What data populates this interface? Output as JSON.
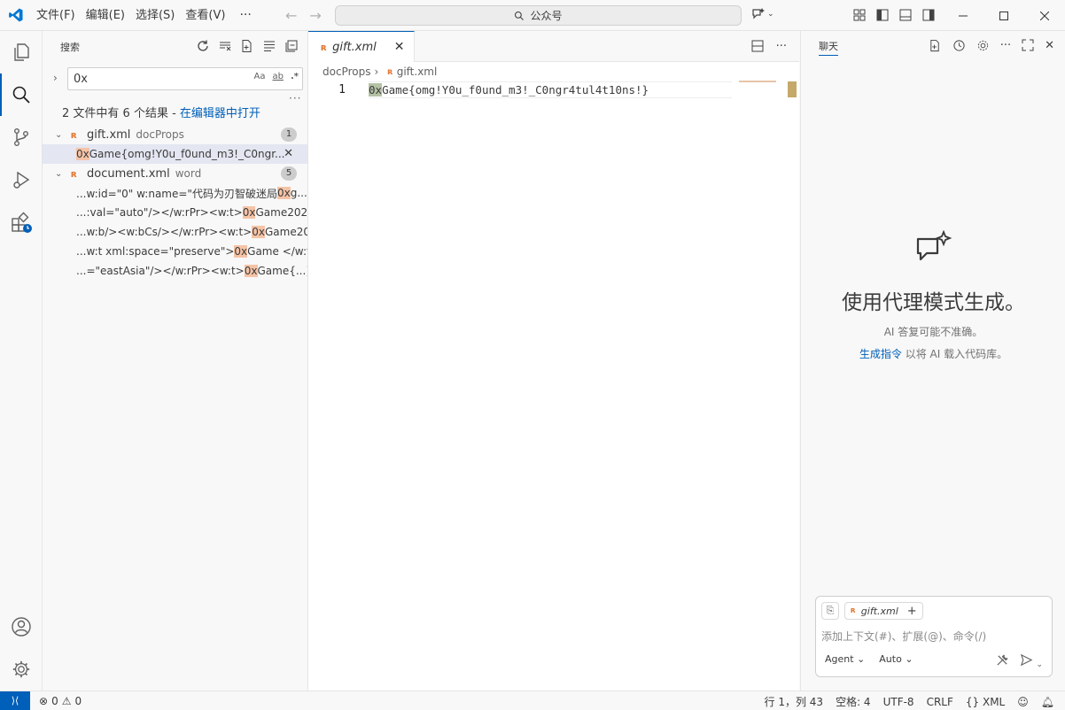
{
  "menu": {
    "items": [
      "文件(F)",
      "编辑(E)",
      "选择(S)",
      "查看(V)"
    ],
    "more": "···"
  },
  "command_center": {
    "text": "公众号"
  },
  "sidebar": {
    "title": "搜索",
    "search": {
      "value": "0x",
      "opt_case": "Aa",
      "opt_word": "ab",
      "opt_regex": ".*"
    },
    "summary": {
      "text": "2 文件中有 6 个结果 - ",
      "link": "在编辑器中打开"
    },
    "files": [
      {
        "name": "gift.xml",
        "dir": "docProps",
        "count": "1",
        "matches": [
          {
            "pre": "",
            "hl": "0x",
            "post": "Game{omg!Y0u_f0und_m3!_C0ngr..."
          }
        ]
      },
      {
        "name": "document.xml",
        "dir": "word",
        "count": "5",
        "matches": [
          {
            "pre": "...w:id=\"0\" w:name=\"代码为刃智破迷局",
            "hl": "0x",
            "post": "g..."
          },
          {
            "pre": "...:val=\"auto\"/></w:rPr><w:t>",
            "hl": "0x",
            "post": "Game2025..."
          },
          {
            "pre": "...w:b/><w:bCs/></w:rPr><w:t>",
            "hl": "0x",
            "post": "Game20..."
          },
          {
            "pre": "...w:t xml:space=\"preserve\"> ",
            "hl": "0x",
            "post": "Game </w:t..."
          },
          {
            "pre": "...=\"eastAsia\"/></w:rPr><w:t>",
            "hl": "0x",
            "post": "Game{...}<..."
          }
        ]
      }
    ]
  },
  "editor": {
    "tab": {
      "label": "gift.xml"
    },
    "breadcrumb": {
      "folder": "docProps",
      "file": "gift.xml"
    },
    "line_number": "1",
    "line": {
      "match": "0x",
      "rest": "Game{omg!Y0u_f0und_m3!_C0ngr4tul4t10ns!}"
    }
  },
  "chat": {
    "title": "聊天",
    "heading": "使用代理模式生成。",
    "subtitle": "AI 答复可能不准确。",
    "hint_link": "生成指令",
    "hint_text": " 以将 AI 载入代码库。",
    "context_chip": "gift.xml",
    "placeholder": "添加上下文(#)、扩展(@)、命令(/)",
    "mode": "Agent",
    "model": "Auto"
  },
  "status": {
    "errors": "0",
    "warnings": "0",
    "position": "行 1，列 43",
    "spaces": "空格: 4",
    "encoding": "UTF-8",
    "eol": "CRLF",
    "language": "XML"
  },
  "colors": {
    "accent": "#005fb8",
    "match_highlight": "#f5c3a6",
    "xml_icon": "#e37933"
  }
}
